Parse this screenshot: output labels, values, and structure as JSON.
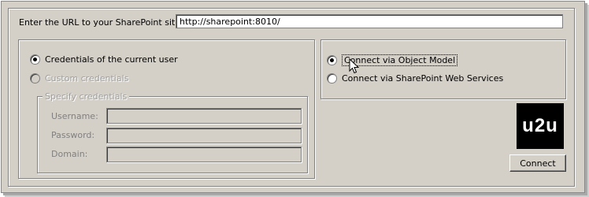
{
  "url": {
    "label": "Enter the URL to your SharePoint site:",
    "value": "http://sharepoint:8010/"
  },
  "credentials": {
    "options": [
      {
        "label": "Credentials of the current user",
        "selected": true,
        "enabled": true
      },
      {
        "label": "Custom credentials",
        "selected": false,
        "enabled": false
      }
    ],
    "specify_group_label": "Specify credentials",
    "fields": [
      {
        "label": "Username:",
        "value": ""
      },
      {
        "label": "Password:",
        "value": ""
      },
      {
        "label": "Domain:",
        "value": ""
      }
    ]
  },
  "connection": {
    "options": [
      {
        "label": "Connect via Object Model",
        "selected": true
      },
      {
        "label": "Connect via SharePoint Web Services",
        "selected": false
      }
    ]
  },
  "logo": {
    "text": "u2u"
  },
  "connect_button": {
    "label": "Connect"
  },
  "icons": [
    "radio-icon",
    "mouse-cursor-icon"
  ]
}
